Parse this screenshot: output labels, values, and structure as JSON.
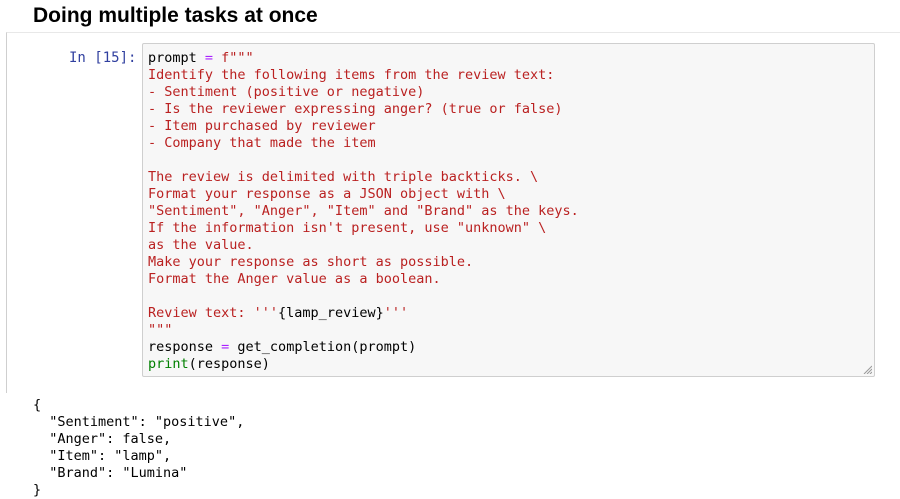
{
  "section": {
    "heading": "Doing multiple tasks at once"
  },
  "cell": {
    "prompt_label": "In [15]:",
    "code": {
      "l1_var": "prompt",
      "l1_eq": " = ",
      "l1_str": "f\"\"\"",
      "body": [
        "Identify the following items from the review text:",
        "- Sentiment (positive or negative)",
        "- Is the reviewer expressing anger? (true or false)",
        "- Item purchased by reviewer",
        "- Company that made the item",
        "",
        "The review is delimited with triple backticks. \\",
        "Format your response as a JSON object with \\",
        "\"Sentiment\", \"Anger\", \"Item\" and \"Brand\" as the keys.",
        "If the information isn't present, use \"unknown\" \\",
        "as the value.",
        "Make your response as short as possible.",
        "Format the Anger value as a boolean.",
        ""
      ],
      "review_prefix": "Review text: '''",
      "review_interp": "{lamp_review}",
      "review_suffix": "'''",
      "close_quotes": "\"\"\"",
      "resp_var": "response",
      "resp_eq": " = ",
      "resp_call": "get_completion(prompt)",
      "print_kw": "print",
      "print_arg": "(response)"
    }
  },
  "output": {
    "lines": [
      "{",
      "  \"Sentiment\": \"positive\",",
      "  \"Anger\": false,",
      "  \"Item\": \"lamp\",",
      "  \"Brand\": \"Lumina\"",
      "}"
    ]
  }
}
